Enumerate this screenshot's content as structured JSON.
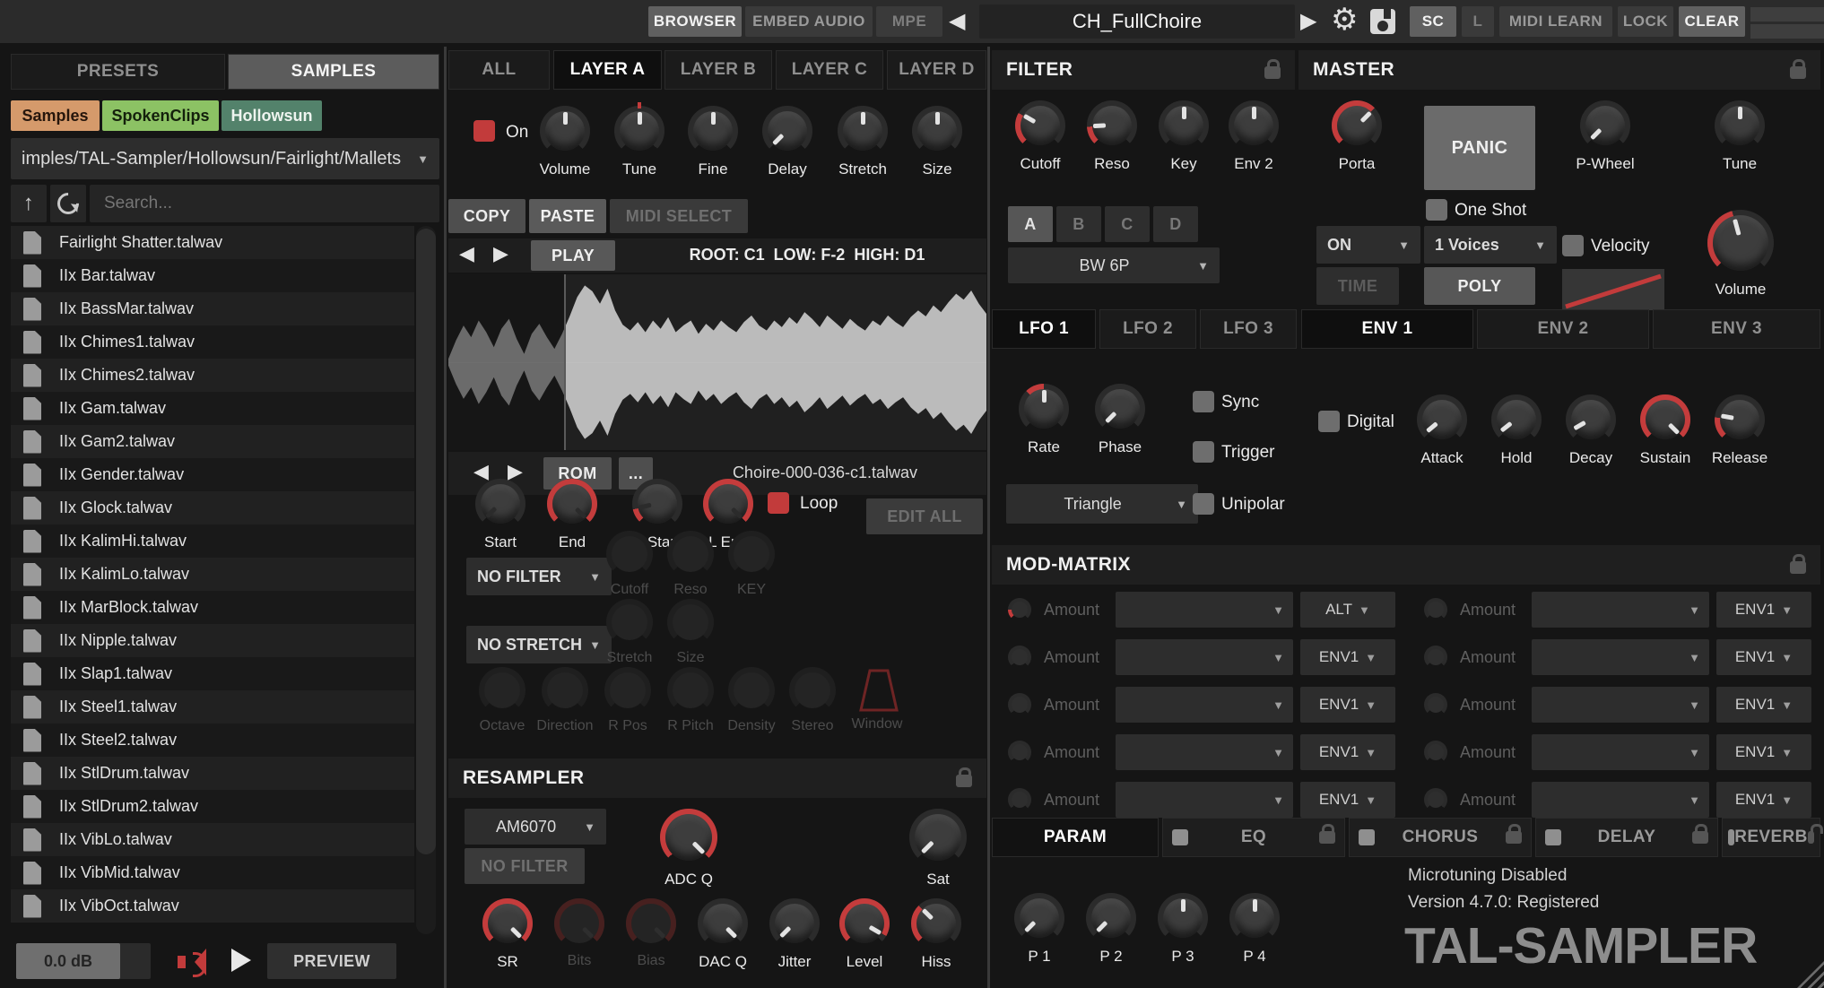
{
  "topbar": {
    "browser": "BROWSER",
    "embed_audio": "EMBED AUDIO",
    "mpe": "MPE",
    "preset_title": "CH_FullChoire",
    "sc": "SC",
    "l": "L",
    "midi_learn": "MIDI LEARN",
    "lock": "LOCK",
    "clear": "CLEAR"
  },
  "browser": {
    "presets_tab": "PRESETS",
    "samples_tab": "SAMPLES",
    "chips": [
      {
        "label": "Samples",
        "color": "#d59a6b"
      },
      {
        "label": "SpokenClips",
        "color": "#8cc264"
      },
      {
        "label": "Hollowsun",
        "color": "#53826b"
      }
    ],
    "path": "imples/TAL-Sampler/Hollowsun/Fairlight/Mallets",
    "search_placeholder": "Search...",
    "files": [
      "Fairlight Shatter.talwav",
      "IIx Bar.talwav",
      "IIx BassMar.talwav",
      "IIx Chimes1.talwav",
      "IIx Chimes2.talwav",
      "IIx Gam.talwav",
      "IIx Gam2.talwav",
      "IIx Gender.talwav",
      "IIx Glock.talwav",
      "IIx KalimHi.talwav",
      "IIx KalimLo.talwav",
      "IIx MarBlock.talwav",
      "IIx Nipple.talwav",
      "IIx Slap1.talwav",
      "IIx Steel1.talwav",
      "IIx Steel2.talwav",
      "IIx StlDrum.talwav",
      "IIx StlDrum2.talwav",
      "IIx VibLo.talwav",
      "IIx VibMid.talwav",
      "IIx VibOct.talwav"
    ],
    "gain": "0.0 dB",
    "preview": "PREVIEW"
  },
  "layer": {
    "tabs": [
      "ALL",
      "LAYER A",
      "LAYER B",
      "LAYER C",
      "LAYER D"
    ],
    "on": "On",
    "volume": "Volume",
    "tune": "Tune",
    "fine": "Fine",
    "delay": "Delay",
    "stretch": "Stretch",
    "size": "Size",
    "copy": "COPY",
    "paste": "PASTE",
    "midi_select": "MIDI SELECT",
    "play": "PLAY",
    "root_info": "ROOT: C1  LOW: F-2  HIGH: D1",
    "rom": "ROM",
    "more": "...",
    "sample_name": "Choire-000-036-c1.talwav",
    "edit_all": "EDIT ALL",
    "start": "Start",
    "end": "End",
    "l_start": "L Start",
    "l_end": "L End",
    "loop": "Loop",
    "no_filter": "NO FILTER",
    "cutoff": "Cutoff",
    "reso": "Reso",
    "key": "KEY",
    "no_stretch": "NO STRETCH",
    "stretch2": "Stretch",
    "size2": "Size",
    "octave": "Octave",
    "direction": "Direction",
    "r_pos": "R Pos",
    "r_pitch": "R Pitch",
    "density": "Density",
    "stereo": "Stereo",
    "window": "Window"
  },
  "resampler": {
    "title": "RESAMPLER",
    "model": "AM6070",
    "no_filter": "NO FILTER",
    "adc_q": "ADC Q",
    "sat": "Sat",
    "sr": "SR",
    "bits": "Bits",
    "bias": "Bias",
    "dac_q": "DAC Q",
    "jitter": "Jitter",
    "level": "Level",
    "hiss": "Hiss"
  },
  "filter": {
    "title": "FILTER",
    "cutoff": "Cutoff",
    "reso": "Reso",
    "key": "Key",
    "env2": "Env 2",
    "a": "A",
    "b": "B",
    "c": "C",
    "d": "D",
    "type": "BW 6P"
  },
  "master": {
    "title": "MASTER",
    "porta": "Porta",
    "panic": "PANIC",
    "one_shot": "One Shot",
    "p_wheel": "P-Wheel",
    "tune": "Tune",
    "porta_mode": "ON",
    "time": "TIME",
    "voices": "1 Voices",
    "poly": "POLY",
    "velocity": "Velocity",
    "volume": "Volume"
  },
  "lfo": {
    "tabs": [
      "LFO 1",
      "LFO 2",
      "LFO 3"
    ],
    "rate": "Rate",
    "phase": "Phase",
    "sync": "Sync",
    "trigger": "Trigger",
    "waveform": "Triangle",
    "unipolar": "Unipolar"
  },
  "env": {
    "tabs": [
      "ENV 1",
      "ENV 2",
      "ENV 3"
    ],
    "digital": "Digital",
    "attack": "Attack",
    "hold": "Hold",
    "decay": "Decay",
    "sustain": "Sustain",
    "release": "Release"
  },
  "modmatrix": {
    "title": "MOD-MATRIX",
    "amount": "Amount",
    "rows_left": [
      {
        "src": "ALT"
      },
      {
        "src": "ENV1"
      },
      {
        "src": "ENV1"
      },
      {
        "src": "ENV1"
      },
      {
        "src": "ENV1"
      }
    ],
    "rows_right": [
      {
        "src": "ENV1"
      },
      {
        "src": "ENV1"
      },
      {
        "src": "ENV1"
      },
      {
        "src": "ENV1"
      },
      {
        "src": "ENV1"
      }
    ]
  },
  "fx": {
    "param": "PARAM",
    "eq": "EQ",
    "chorus": "CHORUS",
    "delay": "DELAY",
    "reverb": "REVERB",
    "p1": "P 1",
    "p2": "P 2",
    "p3": "P 3",
    "p4": "P 4"
  },
  "footer": {
    "microtuning": "Microtuning Disabled",
    "version": "Version 4.7.0: Registered",
    "logo": "TAL-SAMPLER"
  },
  "accent_color": "#c23b3b",
  "waveform": [
    0.04,
    0.26,
    0.44,
    0.3,
    0.5,
    0.36,
    0.18,
    0.4,
    0.52,
    0.28,
    0.1,
    0.34,
    0.46,
    0.3,
    0.16,
    0.34,
    0.55,
    0.78,
    0.92,
    0.85,
    0.7,
    0.88,
    0.62,
    0.45,
    0.38,
    0.48,
    0.36,
    0.5,
    0.4,
    0.54,
    0.36,
    0.44,
    0.5,
    0.34,
    0.46,
    0.38,
    0.5,
    0.42,
    0.36,
    0.48,
    0.56,
    0.44,
    0.38,
    0.5,
    0.42,
    0.54,
    0.46,
    0.6,
    0.52,
    0.42,
    0.56,
    0.48,
    0.4,
    0.52,
    0.44,
    0.38,
    0.5,
    0.44,
    0.56,
    0.48,
    0.42,
    0.54,
    0.62,
    0.55,
    0.68,
    0.6,
    0.72,
    0.82,
    0.75,
    0.86,
    0.7,
    0.58
  ]
}
